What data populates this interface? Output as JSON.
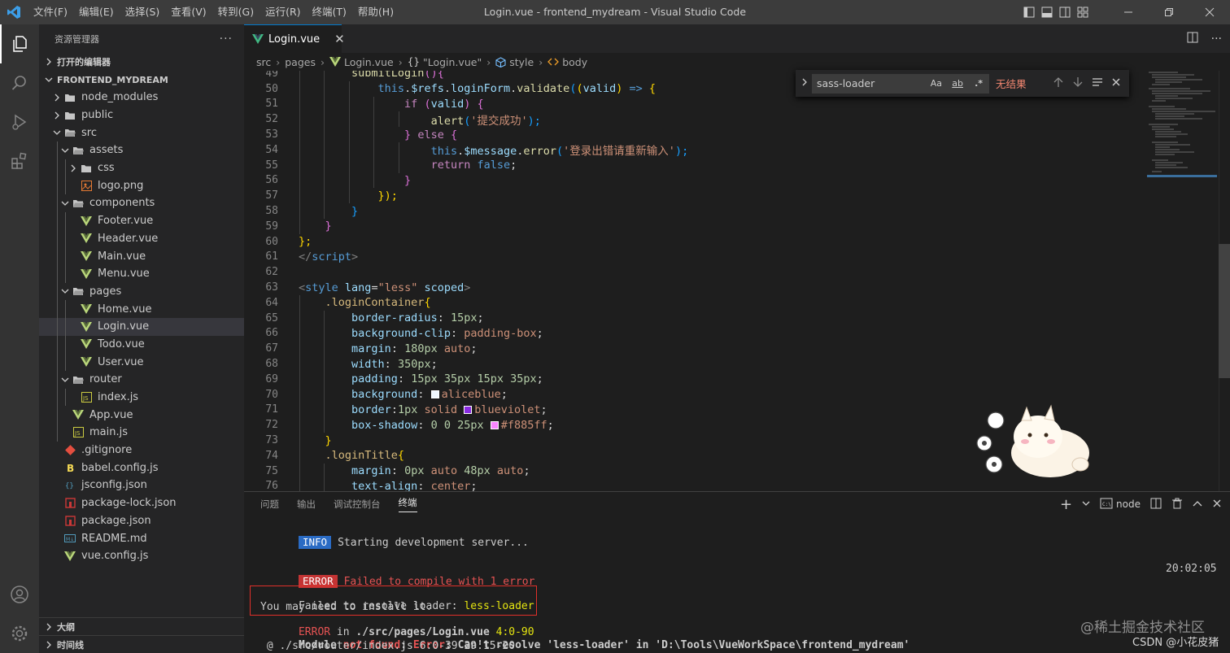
{
  "titlebar": {
    "menus": [
      "文件(F)",
      "编辑(E)",
      "选择(S)",
      "查看(V)",
      "转到(G)",
      "运行(R)",
      "终端(T)",
      "帮助(H)"
    ],
    "title": "Login.vue - frontend_mydream - Visual Studio Code"
  },
  "sidebar": {
    "title": "资源管理器",
    "open_editors": "打开的编辑器",
    "project": "FRONTEND_MYDREAM",
    "tree": [
      {
        "label": "node_modules",
        "icon": "folder-icon",
        "depth": 1,
        "chevron": ">"
      },
      {
        "label": "public",
        "icon": "folder-icon",
        "depth": 1,
        "chevron": ">"
      },
      {
        "label": "src",
        "icon": "folder-open-icon",
        "depth": 1,
        "chevron": "v"
      },
      {
        "label": "assets",
        "icon": "folder-open-icon",
        "depth": 2,
        "chevron": "v"
      },
      {
        "label": "css",
        "icon": "folder-icon",
        "depth": 3,
        "chevron": ">"
      },
      {
        "label": "logo.png",
        "icon": "image-file-icon",
        "depth": 3,
        "chevron": ""
      },
      {
        "label": "components",
        "icon": "folder-open-icon",
        "depth": 2,
        "chevron": "v"
      },
      {
        "label": "Footer.vue",
        "icon": "vue-file-icon",
        "depth": 3,
        "chevron": ""
      },
      {
        "label": "Header.vue",
        "icon": "vue-file-icon",
        "depth": 3,
        "chevron": ""
      },
      {
        "label": "Main.vue",
        "icon": "vue-file-icon",
        "depth": 3,
        "chevron": ""
      },
      {
        "label": "Menu.vue",
        "icon": "vue-file-icon",
        "depth": 3,
        "chevron": ""
      },
      {
        "label": "pages",
        "icon": "folder-open-icon",
        "depth": 2,
        "chevron": "v"
      },
      {
        "label": "Home.vue",
        "icon": "vue-file-icon",
        "depth": 3,
        "chevron": ""
      },
      {
        "label": "Login.vue",
        "icon": "vue-file-icon",
        "depth": 3,
        "chevron": "",
        "selected": true
      },
      {
        "label": "Todo.vue",
        "icon": "vue-file-icon",
        "depth": 3,
        "chevron": ""
      },
      {
        "label": "User.vue",
        "icon": "vue-file-icon",
        "depth": 3,
        "chevron": ""
      },
      {
        "label": "router",
        "icon": "folder-open-icon",
        "depth": 2,
        "chevron": "v"
      },
      {
        "label": "index.js",
        "icon": "js-file-icon",
        "depth": 3,
        "chevron": ""
      },
      {
        "label": "App.vue",
        "icon": "vue-file-icon",
        "depth": 2,
        "chevron": ""
      },
      {
        "label": "main.js",
        "icon": "js-file-icon",
        "depth": 2,
        "chevron": ""
      },
      {
        "label": ".gitignore",
        "icon": "git-file-icon",
        "depth": 1,
        "chevron": ""
      },
      {
        "label": "babel.config.js",
        "icon": "babel-file-icon",
        "depth": 1,
        "chevron": ""
      },
      {
        "label": "jsconfig.json",
        "icon": "json-file-icon",
        "depth": 1,
        "chevron": ""
      },
      {
        "label": "package-lock.json",
        "icon": "npm-file-icon",
        "depth": 1,
        "chevron": ""
      },
      {
        "label": "package.json",
        "icon": "npm-file-icon",
        "depth": 1,
        "chevron": ""
      },
      {
        "label": "README.md",
        "icon": "markdown-file-icon",
        "depth": 1,
        "chevron": ""
      },
      {
        "label": "vue.config.js",
        "icon": "vue-file-icon",
        "depth": 1,
        "chevron": ""
      }
    ],
    "outline": "大纲",
    "timeline": "时间线"
  },
  "editor": {
    "tab_label": "Login.vue",
    "breadcrumb": [
      "src",
      "pages",
      "Login.vue",
      "\"Login.vue\"",
      "style",
      "body"
    ],
    "find": {
      "query": "sass-loader",
      "no_result": "无结果",
      "opt_case": "Aa",
      "opt_word": "ab",
      "opt_regex": ".*"
    },
    "code": [
      {
        "n": "49",
        "t": [
          [
            "        ",
            ""
          ],
          [
            "submitLogin",
            "fn"
          ],
          [
            "(){",
            "br2"
          ]
        ]
      },
      {
        "n": "50",
        "t": [
          [
            "            ",
            ""
          ],
          [
            "this",
            "kw"
          ],
          [
            ".",
            ""
          ],
          [
            "$refs",
            "var"
          ],
          [
            ".",
            ""
          ],
          [
            "loginForm",
            "var"
          ],
          [
            ".",
            ""
          ],
          [
            "validate",
            "fn"
          ],
          [
            "(",
            "br3"
          ],
          [
            "(",
            "br1"
          ],
          [
            "valid",
            "var"
          ],
          [
            ")",
            "br1"
          ],
          [
            " => ",
            "kw"
          ],
          [
            "{",
            "br1"
          ]
        ]
      },
      {
        "n": "51",
        "t": [
          [
            "                ",
            ""
          ],
          [
            "if",
            "ctl"
          ],
          [
            " (",
            "br2"
          ],
          [
            "valid",
            "var"
          ],
          [
            ") {",
            "br2"
          ]
        ]
      },
      {
        "n": "52",
        "t": [
          [
            "                    ",
            ""
          ],
          [
            "alert",
            "fn"
          ],
          [
            "(",
            "br3"
          ],
          [
            "'提交成功'",
            "str"
          ],
          [
            ");",
            "br3"
          ]
        ]
      },
      {
        "n": "53",
        "t": [
          [
            "                ",
            ""
          ],
          [
            "} ",
            "br2"
          ],
          [
            "else",
            "ctl"
          ],
          [
            " {",
            "br2"
          ]
        ]
      },
      {
        "n": "54",
        "t": [
          [
            "                    ",
            ""
          ],
          [
            "this",
            "kw"
          ],
          [
            ".",
            ""
          ],
          [
            "$message",
            "var"
          ],
          [
            ".",
            ""
          ],
          [
            "error",
            "fn"
          ],
          [
            "(",
            "br3"
          ],
          [
            "'登录出错请重新输入'",
            "str"
          ],
          [
            ");",
            "br3"
          ]
        ]
      },
      {
        "n": "55",
        "t": [
          [
            "                    ",
            ""
          ],
          [
            "return",
            "ctl"
          ],
          [
            " ",
            ""
          ],
          [
            "false",
            "kw"
          ],
          [
            ";",
            ""
          ]
        ]
      },
      {
        "n": "56",
        "t": [
          [
            "                ",
            ""
          ],
          [
            "}",
            "br2"
          ]
        ]
      },
      {
        "n": "57",
        "t": [
          [
            "            ",
            ""
          ],
          [
            "});",
            "br1"
          ]
        ]
      },
      {
        "n": "58",
        "t": [
          [
            "        ",
            ""
          ],
          [
            "}",
            "br3"
          ]
        ]
      },
      {
        "n": "59",
        "t": [
          [
            "    ",
            ""
          ],
          [
            "}",
            "br2"
          ]
        ]
      },
      {
        "n": "60",
        "t": [
          [
            "};",
            "br1"
          ]
        ]
      },
      {
        "n": "61",
        "t": [
          [
            "</",
            "tagp"
          ],
          [
            "script",
            "tag"
          ],
          [
            ">",
            "tagp"
          ]
        ]
      },
      {
        "n": "62",
        "t": []
      },
      {
        "n": "63",
        "t": [
          [
            "<",
            "tagp"
          ],
          [
            "style",
            "tag"
          ],
          [
            " ",
            ""
          ],
          [
            "lang",
            "attr"
          ],
          [
            "=",
            ""
          ],
          [
            "\"less\"",
            "str"
          ],
          [
            " ",
            ""
          ],
          [
            "scoped",
            "attr"
          ],
          [
            ">",
            "tagp"
          ]
        ]
      },
      {
        "n": "64",
        "t": [
          [
            "    ",
            ""
          ],
          [
            ".loginContainer",
            "sel"
          ],
          [
            "{",
            "br1"
          ]
        ]
      },
      {
        "n": "65",
        "t": [
          [
            "        ",
            ""
          ],
          [
            "border-radius",
            "prop"
          ],
          [
            ": ",
            ""
          ],
          [
            "15px",
            "num"
          ],
          [
            ";",
            ""
          ]
        ]
      },
      {
        "n": "66",
        "t": [
          [
            "        ",
            ""
          ],
          [
            "background-clip",
            "prop"
          ],
          [
            ": ",
            ""
          ],
          [
            "padding-box",
            "val"
          ],
          [
            ";",
            ""
          ]
        ]
      },
      {
        "n": "67",
        "t": [
          [
            "        ",
            ""
          ],
          [
            "margin",
            "prop"
          ],
          [
            ": ",
            ""
          ],
          [
            "180px",
            "num"
          ],
          [
            " ",
            ""
          ],
          [
            "auto",
            "val"
          ],
          [
            ";",
            ""
          ]
        ]
      },
      {
        "n": "68",
        "t": [
          [
            "        ",
            ""
          ],
          [
            "width",
            "prop"
          ],
          [
            ": ",
            ""
          ],
          [
            "350px",
            "num"
          ],
          [
            ";",
            ""
          ]
        ]
      },
      {
        "n": "69",
        "t": [
          [
            "        ",
            ""
          ],
          [
            "padding",
            "prop"
          ],
          [
            ": ",
            ""
          ],
          [
            "15px 35px 15px 35px",
            "num"
          ],
          [
            ";",
            ""
          ]
        ]
      },
      {
        "n": "70",
        "t": [
          [
            "        ",
            ""
          ],
          [
            "background",
            "prop"
          ],
          [
            ": ",
            ""
          ],
          [
            "#f0f8ff",
            "swatch"
          ],
          [
            "aliceblue",
            "val"
          ],
          [
            ";",
            ""
          ]
        ]
      },
      {
        "n": "71",
        "t": [
          [
            "        ",
            ""
          ],
          [
            "border",
            "prop"
          ],
          [
            ":",
            ""
          ],
          [
            "1px",
            "num"
          ],
          [
            " ",
            ""
          ],
          [
            "solid",
            "val"
          ],
          [
            " ",
            ""
          ],
          [
            "#8a2be2",
            "swatch"
          ],
          [
            "blueviolet",
            "val"
          ],
          [
            ";",
            ""
          ]
        ]
      },
      {
        "n": "72",
        "t": [
          [
            "        ",
            ""
          ],
          [
            "box-shadow",
            "prop"
          ],
          [
            ": ",
            ""
          ],
          [
            "0 0 25px",
            "num"
          ],
          [
            " ",
            ""
          ],
          [
            "#f885ff",
            "swatch"
          ],
          [
            "#f885ff",
            "val"
          ],
          [
            ";",
            ""
          ]
        ]
      },
      {
        "n": "73",
        "t": [
          [
            "    ",
            ""
          ],
          [
            "}",
            "br1"
          ]
        ]
      },
      {
        "n": "74",
        "t": [
          [
            "    ",
            ""
          ],
          [
            ".loginTitle",
            "sel"
          ],
          [
            "{",
            "br1"
          ]
        ]
      },
      {
        "n": "75",
        "t": [
          [
            "        ",
            ""
          ],
          [
            "margin",
            "prop"
          ],
          [
            ": ",
            ""
          ],
          [
            "0px",
            "num"
          ],
          [
            " ",
            ""
          ],
          [
            "auto",
            "val"
          ],
          [
            " ",
            ""
          ],
          [
            "48px",
            "num"
          ],
          [
            " ",
            ""
          ],
          [
            "auto",
            "val"
          ],
          [
            ";",
            ""
          ]
        ]
      },
      {
        "n": "76",
        "t": [
          [
            "        ",
            ""
          ],
          [
            "text-align",
            "prop"
          ],
          [
            ": ",
            ""
          ],
          [
            "center",
            "val"
          ],
          [
            ";",
            ""
          ]
        ]
      }
    ]
  },
  "panel": {
    "tabs": [
      "问题",
      "输出",
      "调试控制台",
      "终端"
    ],
    "active_tab": "终端",
    "terminal_name": "node",
    "lines": {
      "info_badge": "INFO",
      "info_text": "Starting development server...",
      "error_badge": "ERROR",
      "error_text": "Failed to compile with 1 error",
      "error_time": "20:02:05",
      "resolve_prefix": "Failed to resolve loader: ",
      "resolve_loader": "less-loader",
      "install_hint": "You may need to install it.",
      "err_in_label": "ERROR",
      "err_in_word": " in ",
      "err_in_path": "./src/pages/Login.vue",
      "err_in_loc": " 4:0-90",
      "mod_label": "Module ",
      "mod_notfound": "not found",
      "mod_colon": ": ",
      "mod_error": "Error",
      "mod_rest": ": Can't resolve 'less-loader' in 'D:\\Tools\\VueWorkSpace\\frontend_mydream'",
      "at_line": " @ ./src/router/index.js 6:0-39 29:15-20"
    }
  },
  "watermarks": {
    "juejin": "@稀土掘金技术社区",
    "csdn": "CSDN @小花皮猪"
  },
  "colors": {
    "accent": "#007acc",
    "info_badge": "#2a6bc4",
    "error_badge": "#c43434",
    "error_text": "#e55353",
    "highlight_border": "#e0302a",
    "vue_green": "#41b883"
  }
}
